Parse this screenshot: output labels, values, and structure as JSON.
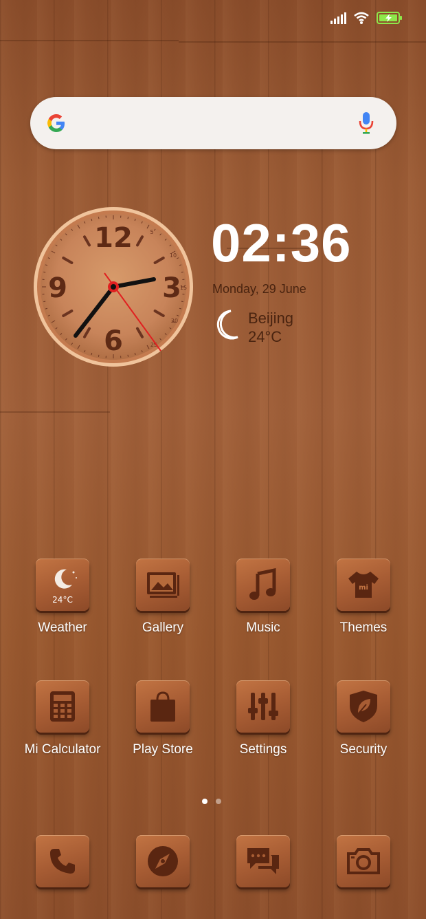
{
  "status_bar": {
    "signal_icon": "signal-icon",
    "wifi_icon": "wifi-icon",
    "battery_icon": "battery-charging-icon"
  },
  "search": {
    "logo": "google-logo-icon",
    "mic": "mic-icon"
  },
  "clock_widget": {
    "time": "02:36",
    "date": "Monday, 29 June",
    "city": "Beijing",
    "temperature": "24°C",
    "weather_icon": "moon-icon",
    "numbers": {
      "top": "12",
      "right": "3",
      "bottom": "6",
      "left": "9"
    },
    "tick_labels": [
      "5",
      "10",
      "15",
      "20",
      "25"
    ]
  },
  "apps": [
    {
      "label": "Weather",
      "icon": "weather-icon",
      "badge": "24°C"
    },
    {
      "label": "Gallery",
      "icon": "gallery-icon"
    },
    {
      "label": "Music",
      "icon": "music-icon"
    },
    {
      "label": "Themes",
      "icon": "themes-icon",
      "badge": "mi"
    },
    {
      "label": "Mi Calculator",
      "icon": "calculator-icon"
    },
    {
      "label": "Play Store",
      "icon": "play-store-icon"
    },
    {
      "label": "Settings",
      "icon": "settings-icon"
    },
    {
      "label": "Security",
      "icon": "security-icon"
    }
  ],
  "page_indicator": {
    "count": 2,
    "active": 0
  },
  "dock": [
    {
      "icon": "phone-icon"
    },
    {
      "icon": "browser-icon"
    },
    {
      "icon": "messaging-icon"
    },
    {
      "icon": "camera-icon"
    }
  ]
}
